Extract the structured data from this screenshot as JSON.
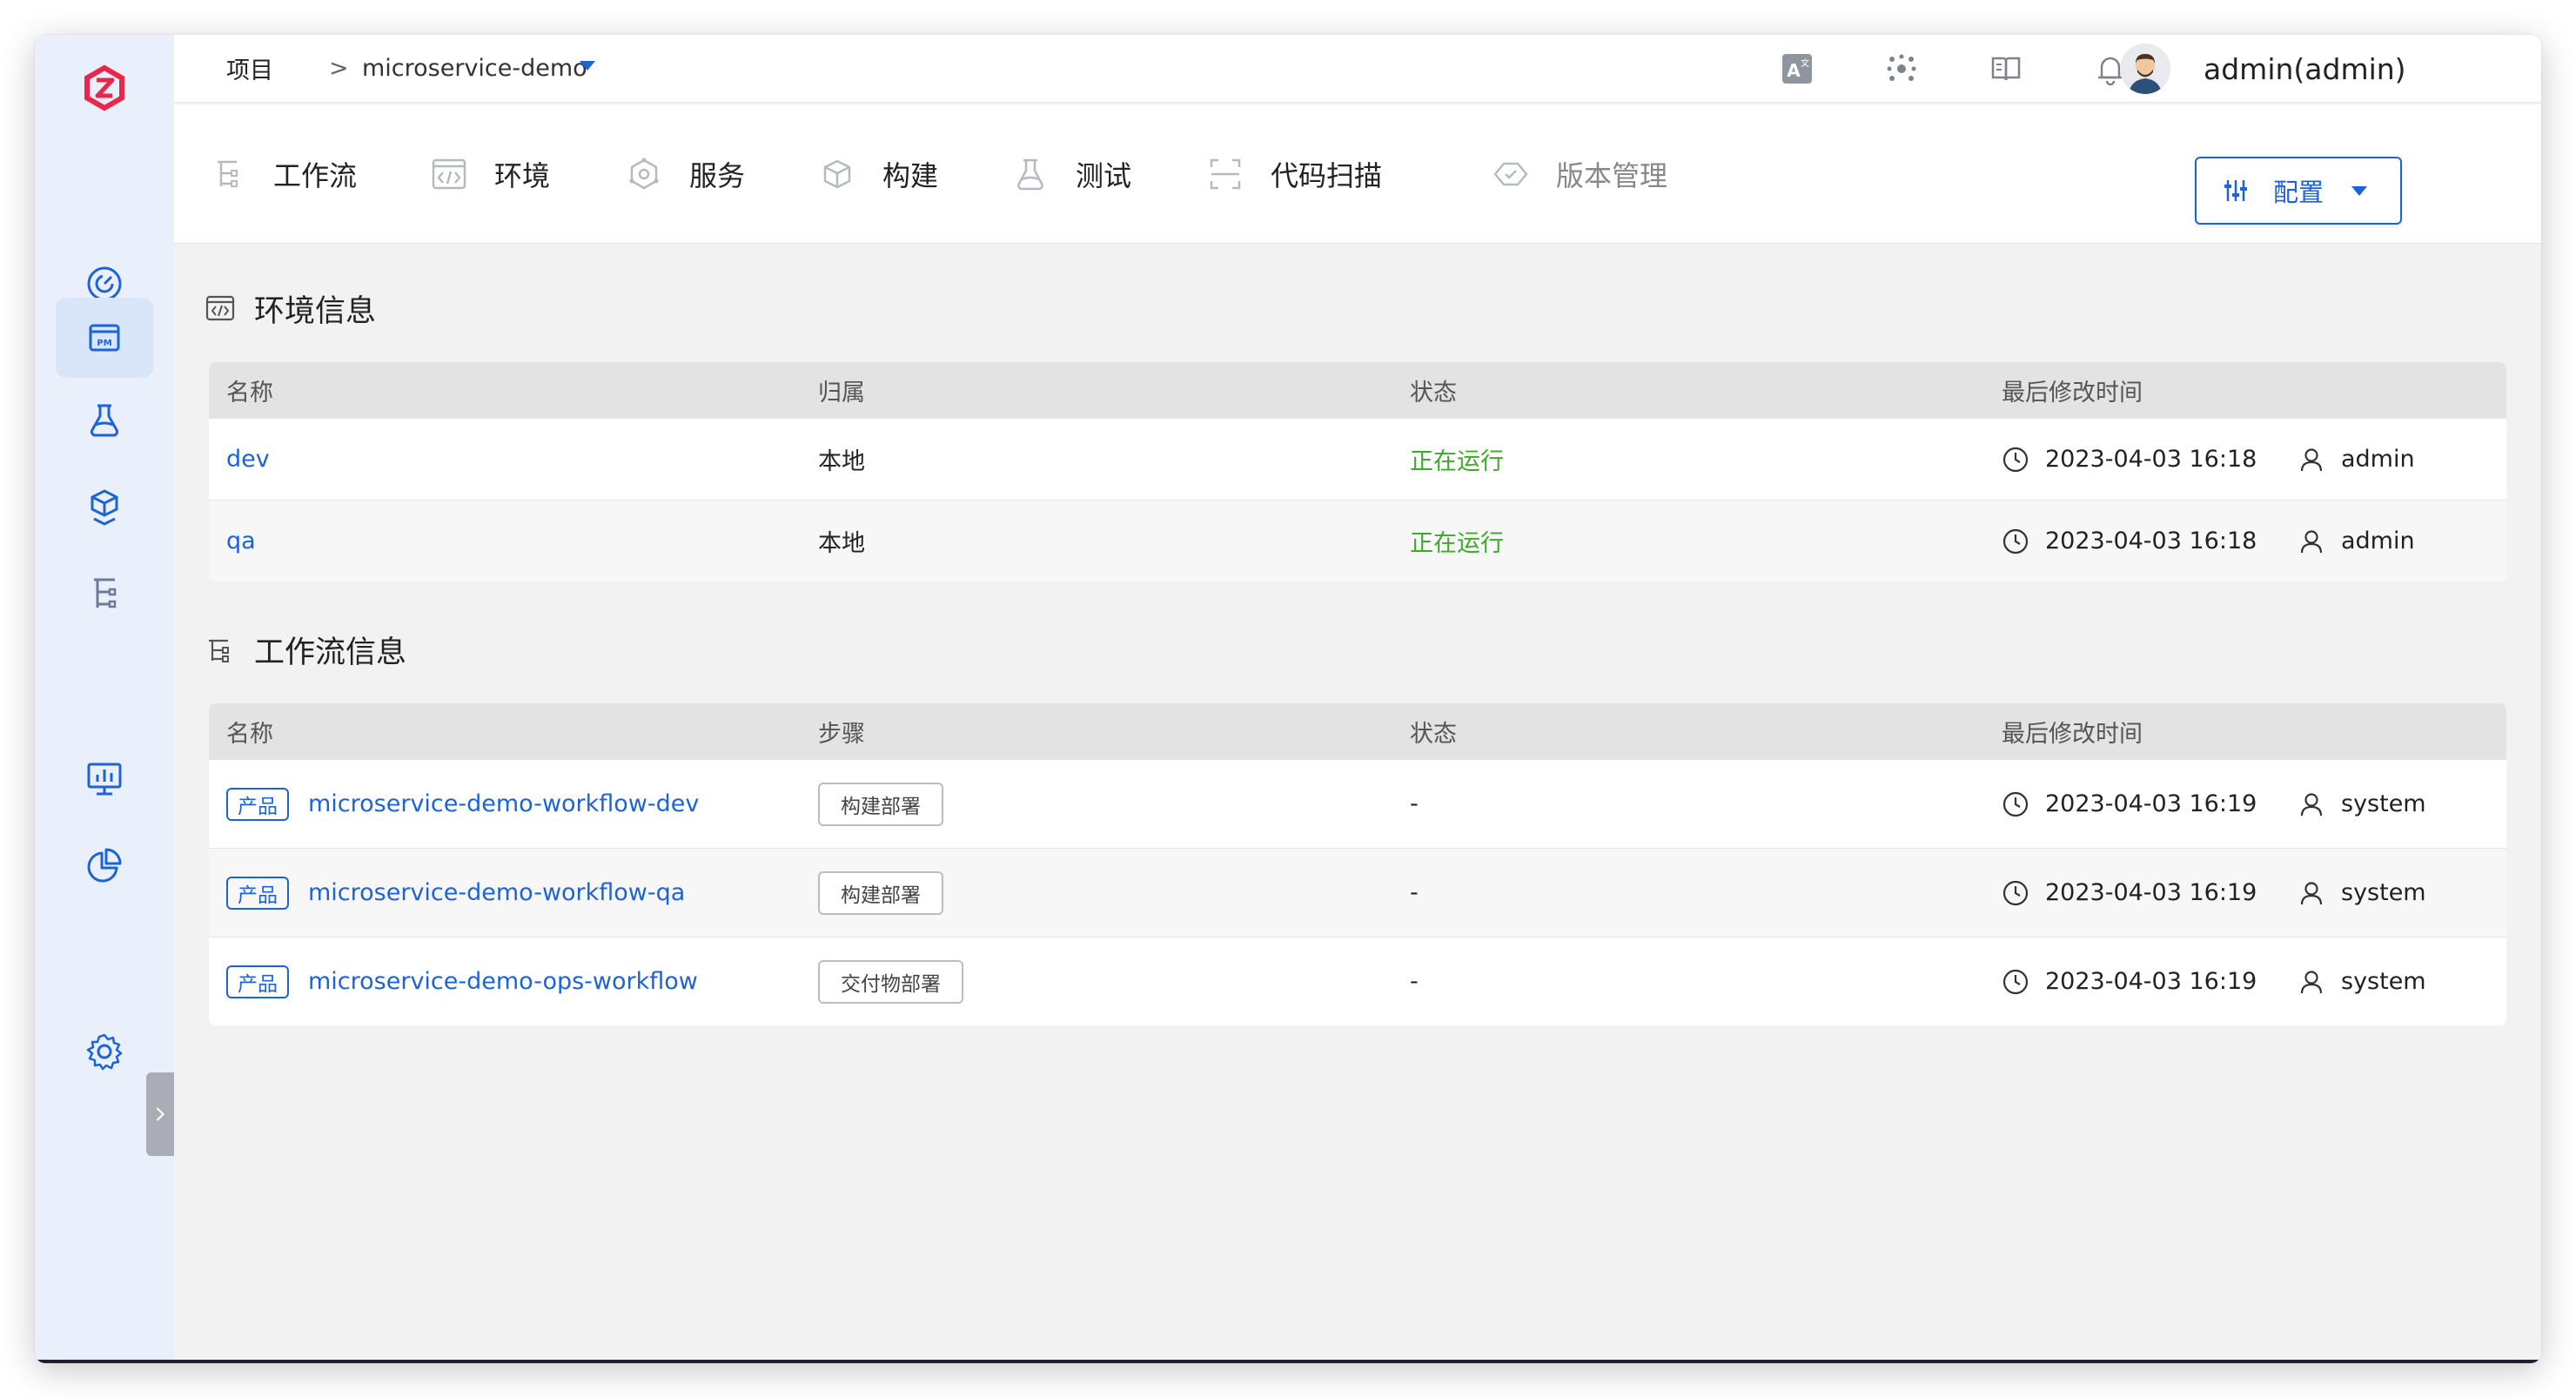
{
  "header": {
    "breadcrumb_root": "项目",
    "breadcrumb_sep": ">",
    "project_name": "microservice-demo",
    "user_name": "admin(admin)"
  },
  "nav": {
    "tabs": [
      {
        "label": "工作流",
        "icon": "workflow-icon"
      },
      {
        "label": "环境",
        "icon": "environment-icon"
      },
      {
        "label": "服务",
        "icon": "service-icon"
      },
      {
        "label": "构建",
        "icon": "build-icon"
      },
      {
        "label": "测试",
        "icon": "test-icon"
      },
      {
        "label": "代码扫描",
        "icon": "code-scan-icon"
      },
      {
        "label": "版本管理",
        "icon": "version-icon"
      }
    ],
    "config_label": "配置"
  },
  "env_section": {
    "title": "环境信息",
    "columns": [
      "名称",
      "归属",
      "状态",
      "最后修改时间"
    ],
    "rows": [
      {
        "name": "dev",
        "owner": "本地",
        "status": "正在运行",
        "time": "2023-04-03 16:18",
        "user": "admin"
      },
      {
        "name": "qa",
        "owner": "本地",
        "status": "正在运行",
        "time": "2023-04-03 16:18",
        "user": "admin"
      }
    ]
  },
  "workflow_section": {
    "title": "工作流信息",
    "columns": [
      "名称",
      "步骤",
      "状态",
      "最后修改时间"
    ],
    "rows": [
      {
        "badge": "产品",
        "name": "microservice-demo-workflow-dev",
        "step": "构建部署",
        "status": "-",
        "time": "2023-04-03 16:19",
        "user": "system"
      },
      {
        "badge": "产品",
        "name": "microservice-demo-workflow-qa",
        "step": "构建部署",
        "status": "-",
        "time": "2023-04-03 16:19",
        "user": "system"
      },
      {
        "badge": "产品",
        "name": "microservice-demo-ops-workflow",
        "step": "交付物部署",
        "status": "-",
        "time": "2023-04-03 16:19",
        "user": "system"
      }
    ]
  },
  "colors": {
    "accent": "#1d63d8",
    "running": "#3cab28",
    "logo": "#e8274b"
  }
}
